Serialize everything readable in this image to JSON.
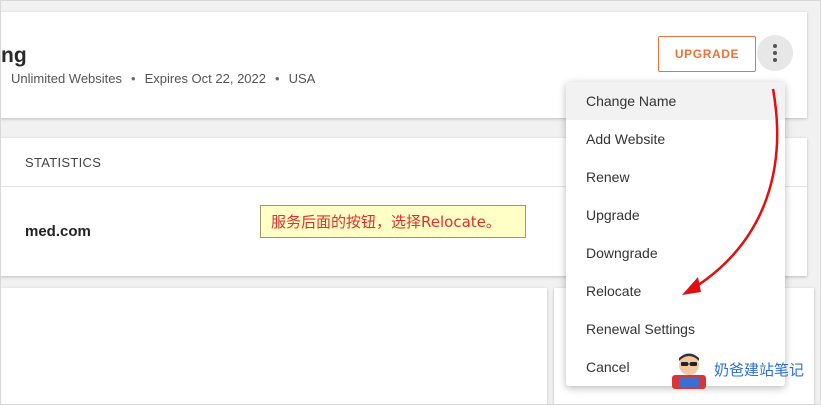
{
  "plan": {
    "title_fragment": "ng",
    "websites": "Unlimited Websites",
    "expires": "Expires Oct 22, 2022",
    "country": "USA",
    "separator": "•",
    "upgrade_label": "UPGRADE"
  },
  "tabs": {
    "statistics": "STATISTICS"
  },
  "site": {
    "domain_fragment": "med.com"
  },
  "annotation": {
    "text": "服务后面的按钮，选择Relocate。"
  },
  "menu": {
    "items": [
      {
        "label": "Change Name"
      },
      {
        "label": "Add Website"
      },
      {
        "label": "Renew"
      },
      {
        "label": "Upgrade"
      },
      {
        "label": "Downgrade"
      },
      {
        "label": "Relocate"
      },
      {
        "label": "Renewal Settings"
      },
      {
        "label": "Cancel"
      }
    ]
  },
  "watermark": {
    "text": "奶爸建站笔记"
  },
  "colors": {
    "accent": "#e8743b",
    "arrow": "#e01010",
    "watermark": "#2b6fd6",
    "tooltip_bg": "#ffffc6"
  }
}
